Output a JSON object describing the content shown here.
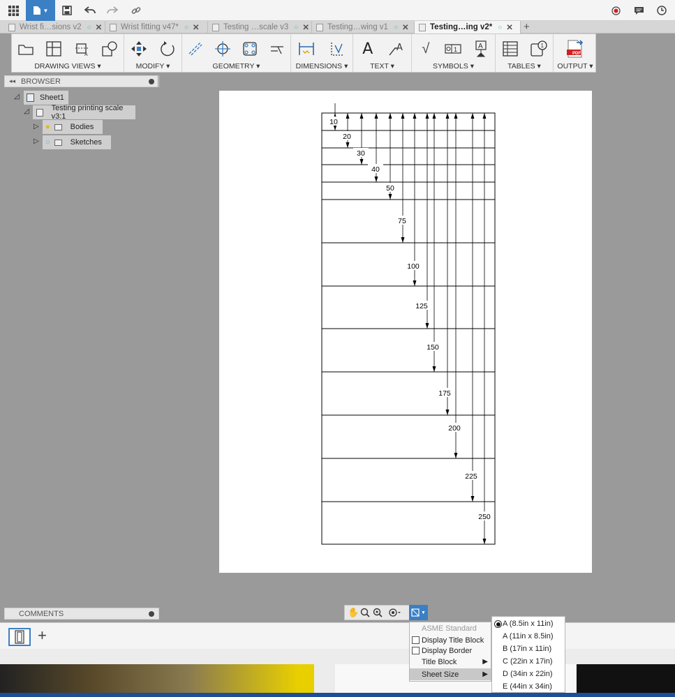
{
  "tabs": [
    {
      "label": "Wrist fi…sions v2"
    },
    {
      "label": "Wrist fitting v47*"
    },
    {
      "label": "Testing …scale v3"
    },
    {
      "label": "Testing…wing v1"
    },
    {
      "label": "Testing…ing v2*"
    }
  ],
  "toolbar": {
    "groups": [
      "DRAWING VIEWS ▾",
      "MODIFY ▾",
      "GEOMETRY ▾",
      "DIMENSIONS ▾",
      "TEXT ▾",
      "SYMBOLS ▾",
      "TABLES ▾",
      "OUTPUT ▾"
    ],
    "pdf": "PDF"
  },
  "browser": {
    "title": "BROWSER",
    "sheet": "Sheet1",
    "view": "Testing printing scale v3:1",
    "bodies": "Bodies",
    "sketches": "Sketches"
  },
  "comments": {
    "title": "COMMENTS"
  },
  "drawing": {
    "dims": [
      "10",
      "20",
      "30",
      "40",
      "50",
      "75",
      "100",
      "125",
      "150",
      "175",
      "200",
      "225",
      "250"
    ]
  },
  "menu": {
    "standard": "ASME Standard",
    "title_block_toggle": "Display Title Block",
    "border_toggle": "Display Border",
    "title_block": "Title Block",
    "sheet_size": "Sheet Size"
  },
  "submenu": [
    "A (8.5in x 11in)",
    "A (11in x 8.5in)",
    "B (17in x 11in)",
    "C (22in x 17in)",
    "D (34in x 22in)",
    "E (44in x 34in)"
  ],
  "colors": {
    "accent": "#3b7fc4",
    "icon": "#2d6aa8"
  }
}
